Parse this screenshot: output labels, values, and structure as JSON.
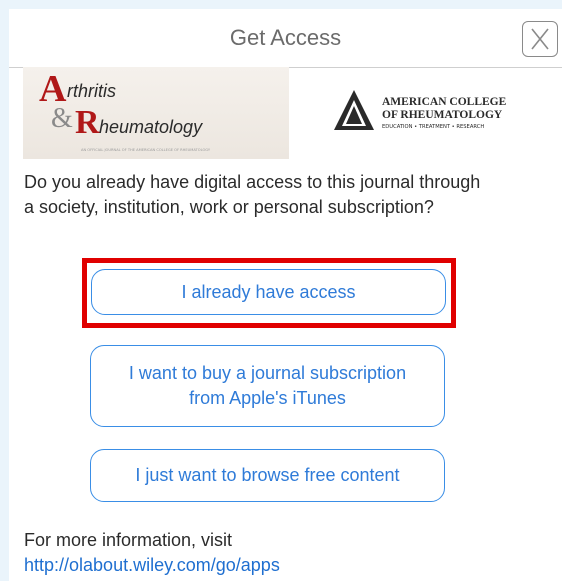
{
  "header": {
    "title": "Get Access",
    "close_label": "X"
  },
  "logos": {
    "journal": {
      "line1": "rthritis",
      "amp": "&",
      "line2": "heumatology",
      "letter_a": "A",
      "letter_r": "R",
      "tagline": "AN OFFICIAL JOURNAL OF THE AMERICAN COLLEGE OF RHEUMATOLOGY"
    },
    "society": {
      "line1": "AMERICAN COLLEGE",
      "line2": "OF RHEUMATOLOGY",
      "line3": "EDUCATION • TREATMENT • RESEARCH"
    }
  },
  "question": "Do you already have digital access to this journal through a society, institution, work or personal subscription?",
  "buttons": {
    "access": "I already have access",
    "buy": "I want to buy a journal subscription from Apple's iTunes",
    "free": "I just want to browse free content"
  },
  "footer": {
    "info": "For more information, visit",
    "link": "http://olabout.wiley.com/go/apps"
  },
  "colors": {
    "accent": "#2f7bd8",
    "highlight": "#e00000",
    "logo_red": "#b01818"
  }
}
